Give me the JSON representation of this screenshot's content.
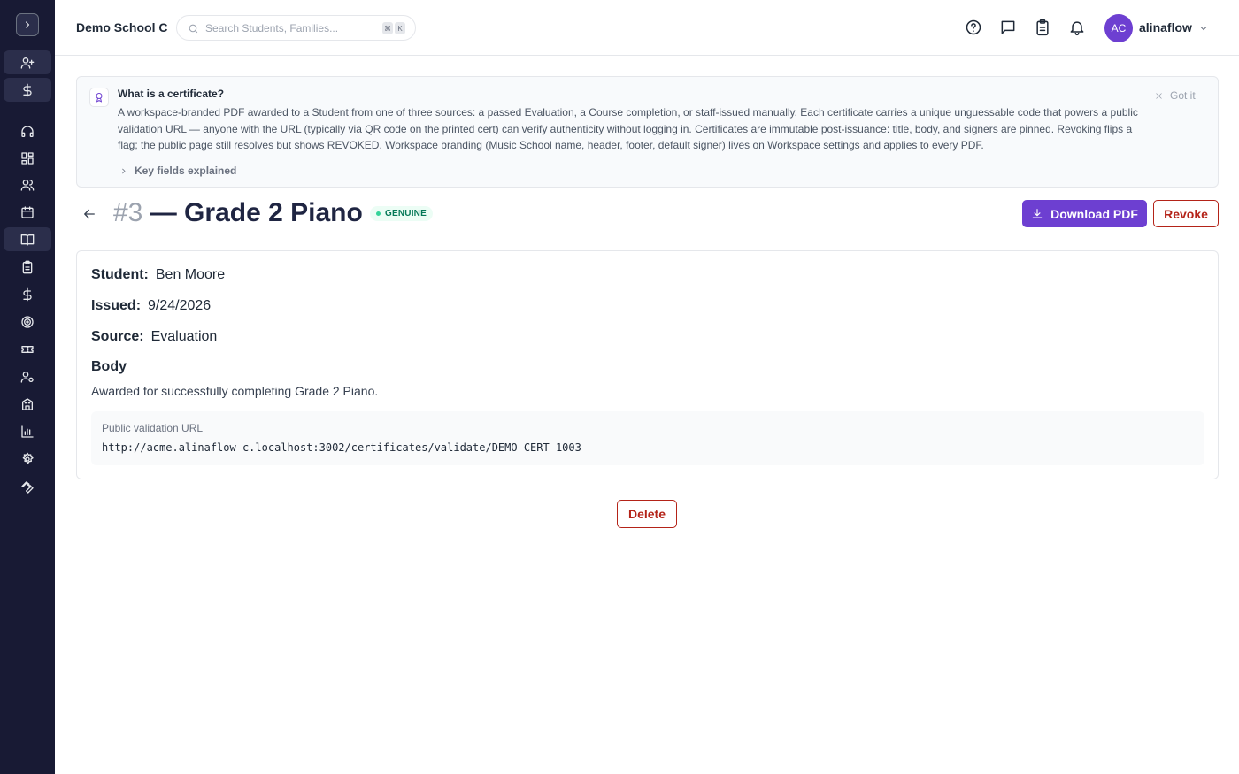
{
  "sidebar": {
    "expand_icon": "chevron-right-icon",
    "items": [
      {
        "icon": "user-plus-icon",
        "boxed": true
      },
      {
        "icon": "dollar-icon",
        "boxed": true
      },
      {
        "icon": "headset-icon"
      },
      {
        "icon": "dashboard-icon"
      },
      {
        "icon": "users-icon"
      },
      {
        "icon": "calendar-icon"
      },
      {
        "icon": "book-open-icon",
        "active": true
      },
      {
        "icon": "clipboard-icon"
      },
      {
        "icon": "dollar-icon"
      },
      {
        "icon": "target-icon"
      },
      {
        "icon": "ticket-icon"
      },
      {
        "icon": "user-settings-icon"
      },
      {
        "icon": "building-icon"
      },
      {
        "icon": "bar-chart-icon"
      },
      {
        "icon": "gear-icon"
      },
      {
        "icon": "wrench-icon"
      }
    ]
  },
  "header": {
    "school_name": "Demo School C",
    "search_placeholder": "Search Students, Families...",
    "shortcut_keys": [
      "⌘",
      "K"
    ],
    "icons": [
      "help-icon",
      "chat-icon",
      "clipboard-icon",
      "bell-icon"
    ],
    "user": {
      "initials": "AC",
      "name": "alinaflow"
    }
  },
  "info_banner": {
    "title": "What is a certificate?",
    "text": "A workspace-branded PDF awarded to a Student from one of three sources: a passed Evaluation, a Course completion, or staff-issued manually. Each certificate carries a unique unguessable code that powers a public validation URL — anyone with the URL (typically via QR code on the printed cert) can verify authenticity without logging in. Certificates are immutable post-issuance: title, body, and signers are pinned. Revoking flips a flag; the public page still resolves but shows REVOKED. Workspace branding (Music School name, header, footer, default signer) lives on Workspace settings and applies to every PDF.",
    "dismiss_label": "Got it",
    "expander_label": "Key fields explained"
  },
  "page": {
    "number": "#3",
    "title": "— Grade 2 Piano",
    "status_badge": "GENUINE",
    "download_label": "Download PDF",
    "revoke_label": "Revoke",
    "delete_label": "Delete"
  },
  "certificate": {
    "student_label": "Student:",
    "student": "Ben Moore",
    "issued_label": "Issued:",
    "issued": "9/24/2026",
    "source_label": "Source:",
    "source": "Evaluation",
    "body_label": "Body",
    "body": "Awarded for successfully completing Grade 2 Piano.",
    "url_label": "Public validation URL",
    "url": "http://acme.alinaflow-c.localhost:3002/certificates/validate/DEMO-CERT-1003"
  },
  "colors": {
    "sidebar_bg": "#181a34",
    "accent": "#6d3fd1",
    "danger": "#b42318",
    "genuine_bg": "#ecfdf5",
    "genuine_text": "#047857"
  }
}
